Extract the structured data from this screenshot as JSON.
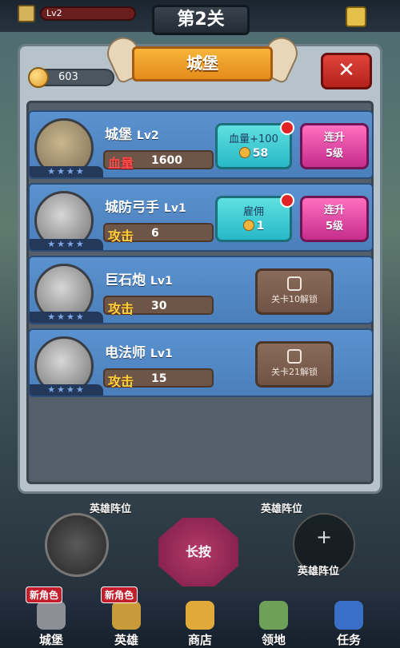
{
  "header": {
    "level_bar": "Lv2",
    "level_title": "第2关"
  },
  "panel": {
    "title": "城堡",
    "close_label": "✕",
    "coins": "603",
    "rows": [
      {
        "name": "城堡",
        "level": "Lv2",
        "stat_key": "血量",
        "stat_val": "1600",
        "action_line1": "血量+100",
        "action_line2": "58",
        "upgrade_line1": "连升",
        "upgrade_line2": "5级"
      },
      {
        "name": "城防弓手",
        "level": "Lv1",
        "stat_key": "攻击",
        "stat_val": "6",
        "action_line1": "雇佣",
        "action_line2": "1",
        "upgrade_line1": "连升",
        "upgrade_line2": "5级"
      },
      {
        "name": "巨石炮",
        "level": "Lv1",
        "stat_key": "攻击",
        "stat_val": "30",
        "lock_text": "关卡10解锁"
      },
      {
        "name": "电法师",
        "level": "Lv1",
        "stat_key": "攻击",
        "stat_val": "15",
        "lock_text": "关卡21解锁"
      }
    ]
  },
  "bottom": {
    "formation_left": "英雄阵位",
    "formation_right": "英雄阵位",
    "long_press": "长按",
    "add_plus": "+",
    "add_label": "英雄阵位"
  },
  "tabs": [
    {
      "label": "城堡",
      "badge": "新角色"
    },
    {
      "label": "英雄",
      "badge": "新角色"
    },
    {
      "label": "商店"
    },
    {
      "label": "领地"
    },
    {
      "label": "任务"
    }
  ]
}
